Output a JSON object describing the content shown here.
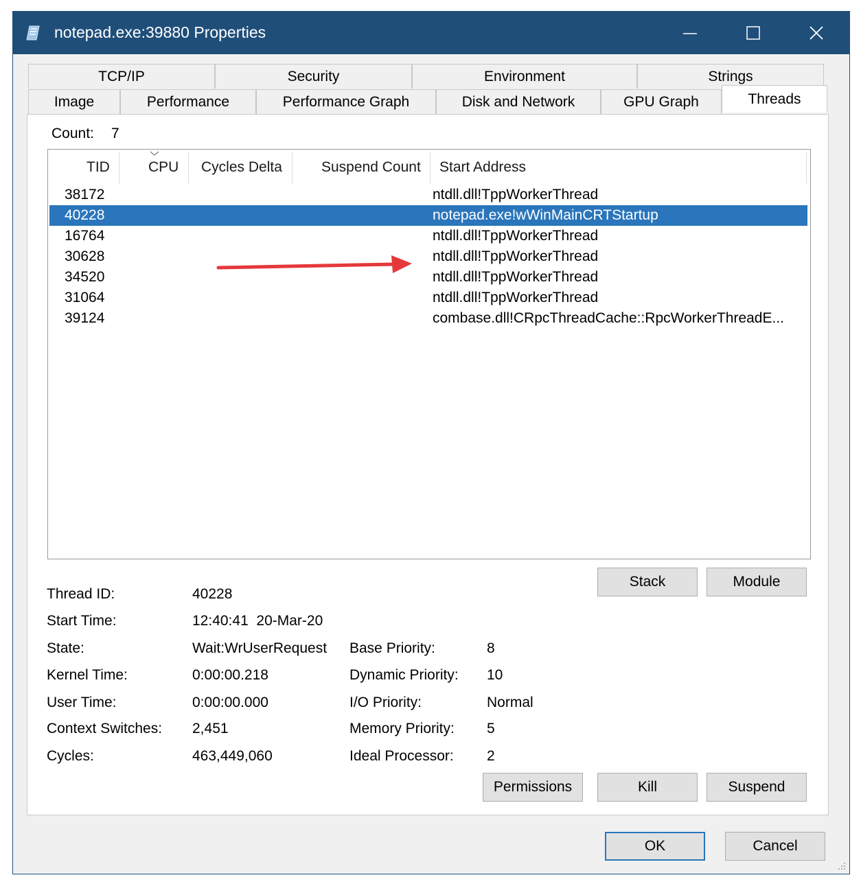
{
  "window": {
    "title": "notepad.exe:39880 Properties",
    "icon": "notepad-icon"
  },
  "tabs": {
    "row1": [
      "TCP/IP",
      "Security",
      "Environment",
      "Strings"
    ],
    "row2": [
      "Image",
      "Performance",
      "Performance Graph",
      "Disk and Network",
      "GPU Graph",
      "Threads"
    ],
    "active": "Threads"
  },
  "threads": {
    "count_label": "Count:",
    "count_value": "7",
    "columns": [
      "TID",
      "CPU",
      "Cycles Delta",
      "Suspend Count",
      "Start Address"
    ],
    "sorted_column": "CPU",
    "rows": [
      {
        "tid": "38172",
        "address": "ntdll.dll!TppWorkerThread"
      },
      {
        "tid": "40228",
        "address": "notepad.exe!wWinMainCRTStartup",
        "selected": true
      },
      {
        "tid": "16764",
        "address": "ntdll.dll!TppWorkerThread"
      },
      {
        "tid": "30628",
        "address": "ntdll.dll!TppWorkerThread"
      },
      {
        "tid": "34520",
        "address": "ntdll.dll!TppWorkerThread"
      },
      {
        "tid": "31064",
        "address": "ntdll.dll!TppWorkerThread"
      },
      {
        "tid": "39124",
        "address": "combase.dll!CRpcThreadCache::RpcWorkerThreadE..."
      }
    ]
  },
  "details": {
    "thread_id_label": "Thread ID:",
    "thread_id": "40228",
    "start_time_label": "Start Time:",
    "start_time": "12:40:41  20-Mar-20",
    "state_label": "State:",
    "state": "Wait:WrUserRequest",
    "kernel_time_label": "Kernel Time:",
    "kernel_time": "0:00:00.218",
    "user_time_label": "User Time:",
    "user_time": "0:00:00.000",
    "context_switches_label": "Context Switches:",
    "context_switches": "2,451",
    "cycles_label": "Cycles:",
    "cycles": "463,449,060",
    "base_priority_label": "Base Priority:",
    "base_priority": "8",
    "dynamic_priority_label": "Dynamic Priority:",
    "dynamic_priority": "10",
    "io_priority_label": "I/O Priority:",
    "io_priority": "Normal",
    "memory_priority_label": "Memory Priority:",
    "memory_priority": "5",
    "ideal_processor_label": "Ideal Processor:",
    "ideal_processor": "2"
  },
  "buttons": {
    "stack": "Stack",
    "module": "Module",
    "permissions": "Permissions",
    "kill": "Kill",
    "suspend": "Suspend",
    "ok": "OK",
    "cancel": "Cancel"
  },
  "colors": {
    "titlebar": "#1f4e79",
    "selection": "#2a75bb",
    "annotation_arrow": "#e5383b"
  }
}
